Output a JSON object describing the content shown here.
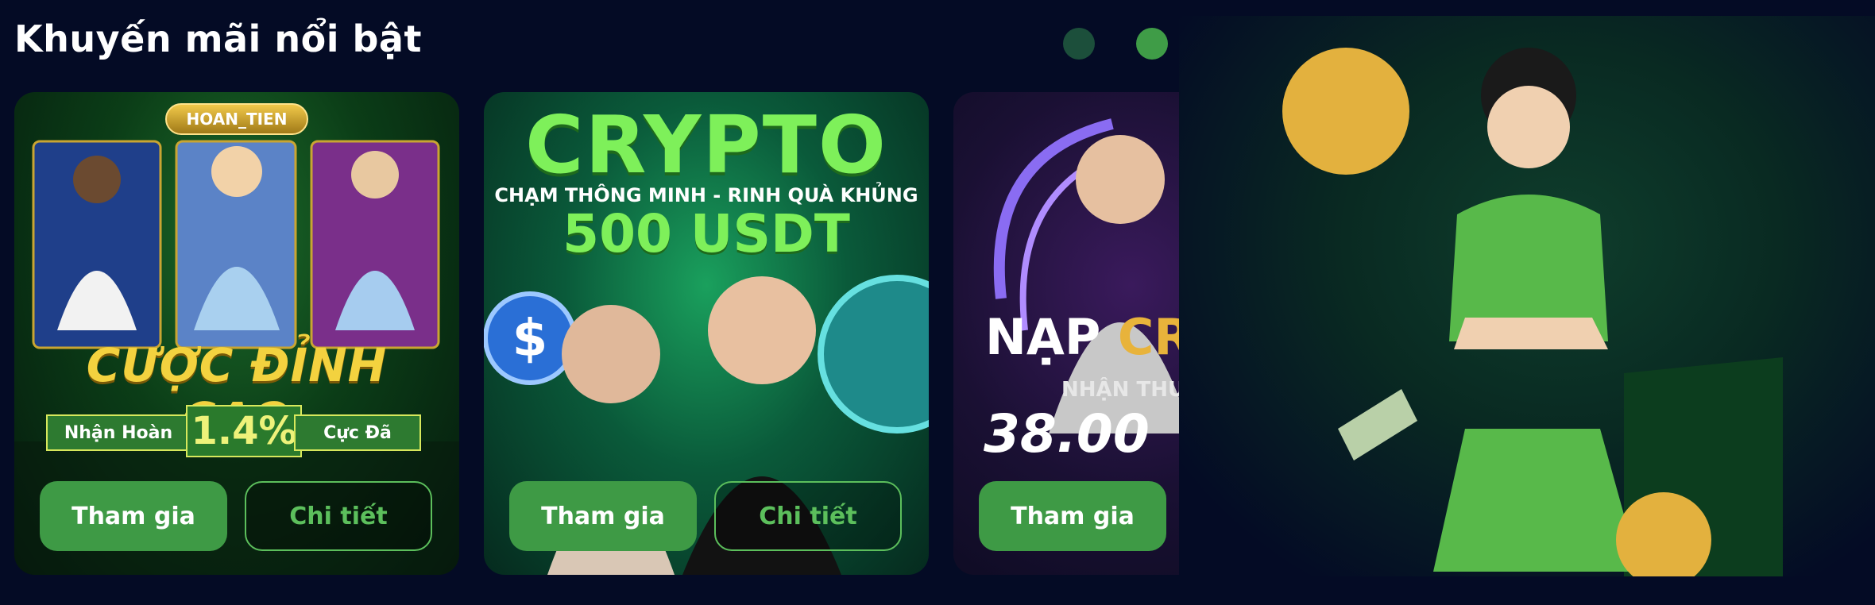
{
  "section": {
    "title": "Khuyến mãi nổi bật"
  },
  "carousel_nav": {
    "prev_icon": "chevron-left-icon",
    "next_icon": "chevron-right-icon"
  },
  "cards": [
    {
      "badge": "HOAN_TIEN",
      "headline": "CƯỢC ĐỈNH CAO",
      "left_pill": "Nhận Hoàn",
      "percent": "1.4%",
      "right_pill": "Cực Đã",
      "join_label": "Tham gia",
      "detail_label": "Chi tiết"
    },
    {
      "title": "CRYPTO",
      "subtitle": "CHẠM THÔNG MINH - RINH QUÀ KHỦNG",
      "amount": "500 USDT",
      "join_label": "Tham gia",
      "detail_label": "Chi tiết"
    },
    {
      "line1_prefix": "NẠP ",
      "line1_highlight": "CR",
      "line2": "NHẬN THƯ",
      "line3": "38.00",
      "join_label": "Tham gia"
    }
  ],
  "colors": {
    "background": "#040b25",
    "accent": "#3e9a45",
    "accent_light": "#5cbf5c"
  }
}
